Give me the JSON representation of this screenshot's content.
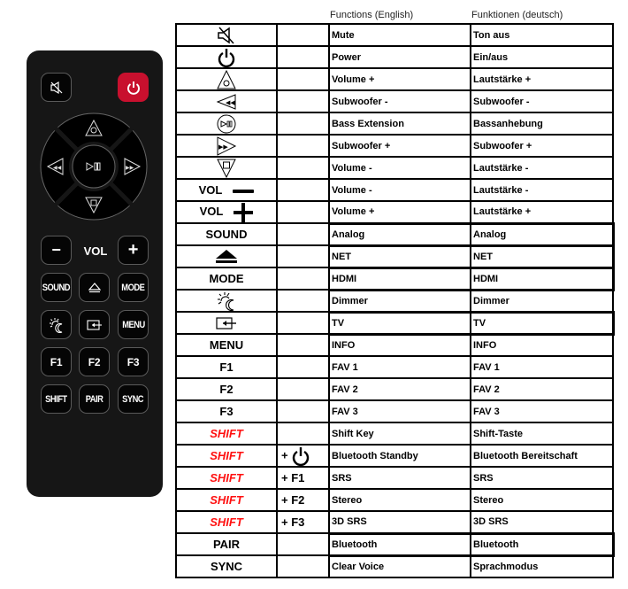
{
  "remote": {
    "power_color": "#c8102e",
    "body_color": "#161616",
    "top_buttons": [
      {
        "name": "mute",
        "icon": "mute-icon"
      },
      {
        "name": "power",
        "icon": "power-icon"
      }
    ],
    "dpad": {
      "up": "volume-up-icon",
      "left": "subwoofer-down-icon",
      "center": "play-pause-icon",
      "right": "subwoofer-up-icon",
      "down": "volume-down-icon"
    },
    "vol_row": {
      "minus": "−",
      "label": "VOL",
      "plus": "+"
    },
    "grid": [
      [
        "SOUND",
        "eject-icon",
        "MODE"
      ],
      [
        "dimmer-icon",
        "input-icon",
        "MENU"
      ],
      [
        "F1",
        "F2",
        "F3"
      ],
      [
        "SHIFT",
        "PAIR",
        "SYNC"
      ]
    ]
  },
  "table": {
    "header_en": "Functions (English)",
    "header_de": "Funktionen (deutsch)",
    "rows": [
      {
        "key": "",
        "icon": "mute-icon",
        "mod": "",
        "en": "Mute",
        "de": "Ton aus"
      },
      {
        "key": "",
        "icon": "power-icon",
        "mod": "",
        "en": "Power",
        "de": "Ein/aus"
      },
      {
        "key": "",
        "icon": "volume-up-icon",
        "mod": "",
        "en": "Volume +",
        "de": "Lautstärke +"
      },
      {
        "key": "",
        "icon": "subwoofer-down-icon",
        "mod": "",
        "en": "Subwoofer -",
        "de": "Subwoofer -"
      },
      {
        "key": "",
        "icon": "play-pause-icon",
        "mod": "",
        "en": "Bass Extension",
        "de": "Bassanhebung"
      },
      {
        "key": "",
        "icon": "subwoofer-up-icon",
        "mod": "",
        "en": "Subwoofer +",
        "de": "Subwoofer +"
      },
      {
        "key": "",
        "icon": "volume-down-icon",
        "mod": "",
        "en": "Volume -",
        "de": "Lautstärke -"
      },
      {
        "key": "VOL",
        "icon": "minus-icon",
        "mod": "",
        "en": "Volume -",
        "de": "Lautstärke -"
      },
      {
        "key": "VOL",
        "icon": "plus-icon",
        "mod": "",
        "en": "Volume +",
        "de": "Lautstärke +"
      },
      {
        "key": "SOUND",
        "icon": "",
        "mod": "",
        "en": "Analog",
        "de": "Analog"
      },
      {
        "key": "",
        "icon": "eject-icon",
        "mod": "",
        "en": "NET",
        "de": "NET"
      },
      {
        "key": "MODE",
        "icon": "",
        "mod": "",
        "en": "HDMI",
        "de": "HDMI"
      },
      {
        "key": "",
        "icon": "dimmer-icon",
        "mod": "",
        "en": "Dimmer",
        "de": "Dimmer"
      },
      {
        "key": "",
        "icon": "input-icon",
        "mod": "",
        "en": "TV",
        "de": "TV"
      },
      {
        "key": "MENU",
        "icon": "",
        "mod": "",
        "en": "INFO",
        "de": "INFO"
      },
      {
        "key": "F1",
        "icon": "",
        "mod": "",
        "en": "FAV 1",
        "de": "FAV 1"
      },
      {
        "key": "F2",
        "icon": "",
        "mod": "",
        "en": "FAV 2",
        "de": "FAV 2"
      },
      {
        "key": "F3",
        "icon": "",
        "mod": "",
        "en": "FAV 3",
        "de": "FAV 3"
      },
      {
        "key": "SHIFT",
        "icon": "",
        "mod": "",
        "en": "Shift Key",
        "de": "Shift-Taste"
      },
      {
        "key": "SHIFT",
        "icon": "",
        "mod": "+",
        "mod_icon": "power-icon",
        "en": "Bluetooth Standby",
        "de": "Bluetooth Bereitschaft"
      },
      {
        "key": "SHIFT",
        "icon": "",
        "mod": "+ F1",
        "en": "SRS",
        "de": "SRS"
      },
      {
        "key": "SHIFT",
        "icon": "",
        "mod": "+ F2",
        "en": "Stereo",
        "de": "Stereo"
      },
      {
        "key": "SHIFT",
        "icon": "",
        "mod": "+ F3",
        "en": "3D SRS",
        "de": "3D SRS"
      },
      {
        "key": "PAIR",
        "icon": "",
        "mod": "",
        "en": "Bluetooth",
        "de": "Bluetooth"
      },
      {
        "key": "SYNC",
        "icon": "",
        "mod": "",
        "en": "Clear Voice",
        "de": "Sprachmodus"
      }
    ],
    "shift_color": "#ff1010"
  }
}
